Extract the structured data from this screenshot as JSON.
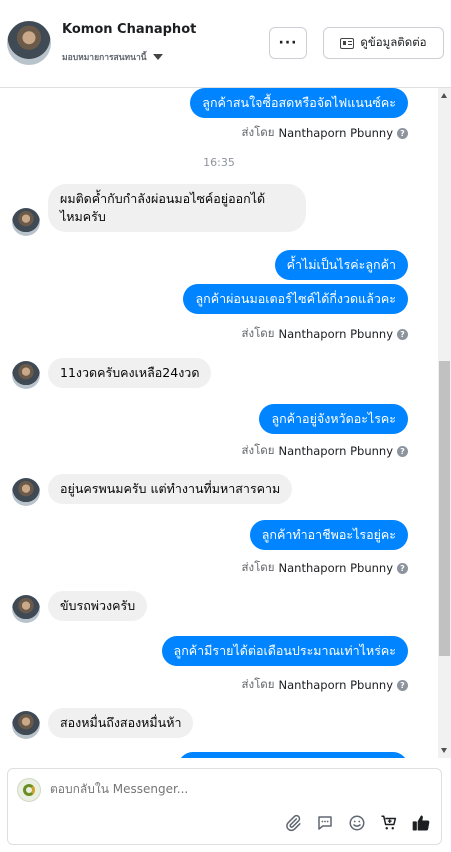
{
  "header": {
    "name": "Komon Chanaphot",
    "assigned_label": "มอบหมายการสนทนานี้",
    "more_label": "···",
    "info_button_label": "ดูข้อมูลติดต่อ"
  },
  "conversation": {
    "messages": [
      {
        "type": "outgoing",
        "text": "ลูกค้าสนใจซื้อสดหรือจัดไฟแนนซ์คะ"
      },
      {
        "type": "sent_by",
        "prefix": "ส่งโดย",
        "name": "Nanthaporn Pbunny"
      },
      {
        "type": "time",
        "text": "16:35"
      },
      {
        "type": "incoming",
        "lines": [
          "ผมติดค้ำกับกำลังผ่อนมอไซค์อยู่ออกได้",
          "ไหมครับ"
        ]
      },
      {
        "type": "outgoing",
        "text": "ค้ำไม่เป็นไรค่ะลูกค้า"
      },
      {
        "type": "outgoing",
        "text": "ลูกค้าผ่อนมอเตอร์ไซค์ได้กี่งวดแล้วคะ"
      },
      {
        "type": "sent_by",
        "prefix": "ส่งโดย",
        "name": "Nanthaporn Pbunny"
      },
      {
        "type": "incoming",
        "text": "11งวดครับคงเหลือ24งวด"
      },
      {
        "type": "outgoing",
        "text": "ลูกค้าอยู่จังหวัดอะไรคะ"
      },
      {
        "type": "sent_by",
        "prefix": "ส่งโดย",
        "name": "Nanthaporn Pbunny"
      },
      {
        "type": "incoming",
        "text": "อยู่นครพนมครับ แต่ทำงานที่มหาสารคาม"
      },
      {
        "type": "outgoing",
        "text": "ลูกค้าทำอาชีพอะไรอยู่คะ"
      },
      {
        "type": "sent_by",
        "prefix": "ส่งโดย",
        "name": "Nanthaporn Pbunny"
      },
      {
        "type": "incoming",
        "text": "ขับรถพ่วงครับ"
      },
      {
        "type": "outgoing",
        "text": "ลูกค้ามีรายได้ต่อเดือนประมาณเท่าไหร่คะ"
      },
      {
        "type": "sent_by",
        "prefix": "ส่งโดย",
        "name": "Nanthaporn Pbunny"
      },
      {
        "type": "incoming",
        "text": "สองหมื่นถึงสองหมื่นห้า"
      }
    ]
  },
  "composer": {
    "placeholder": "ตอบกลับใน Messenger...",
    "icons": [
      "paperclip-icon",
      "saved-reply-icon",
      "emoji-icon",
      "cart-icon",
      "thumbs-up-icon"
    ]
  },
  "colors": {
    "outgoing_bubble": "#0084ff",
    "incoming_bubble": "#f0f0f0",
    "like_icon": "#1c1e21"
  }
}
